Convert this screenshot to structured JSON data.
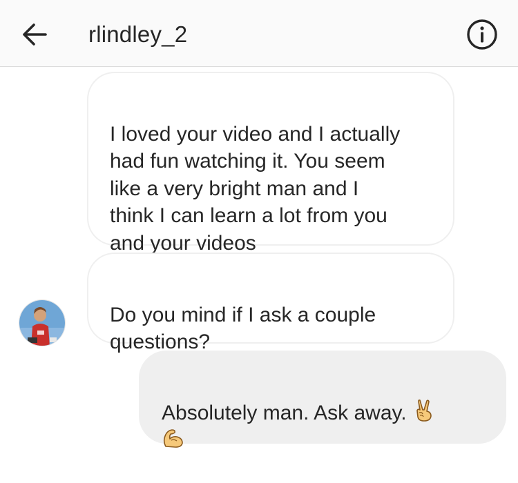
{
  "header": {
    "username": "rlindley_2",
    "back_icon": "arrow-left-icon",
    "info_icon": "info-circle-icon"
  },
  "messages": [
    {
      "sender": "rlindley_2",
      "text": "I loved your video and I actually\nhad fun watching it. You seem\nlike a very bright man and I\nthink I can learn a lot from you\nand your videos"
    },
    {
      "sender": "rlindley_2",
      "text": "Do you mind if I ask a couple\nquestions?"
    },
    {
      "sender": "me",
      "text": "Absolutely man. Ask away.",
      "emoji": [
        "victory-hand-icon",
        "flexed-biceps-icon"
      ]
    }
  ],
  "colors": {
    "header_bg": "#fafafa",
    "sent_bubble": "#efefef",
    "received_border": "#efefef",
    "text": "#262626"
  }
}
